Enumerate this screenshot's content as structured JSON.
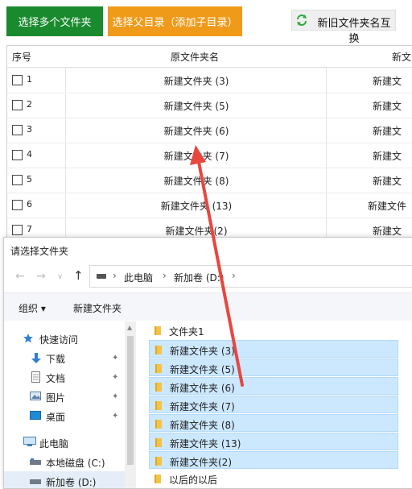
{
  "toolbar": {
    "select_folders": "选择多个文件夹",
    "select_parent": "选择父目录（添加子目录）",
    "swap_names": "新旧文件夹名互换"
  },
  "table": {
    "headers": {
      "seq": "序号",
      "original": "原文件夹名",
      "new": "新文"
    },
    "rows": [
      {
        "num": "1",
        "original": "新建文件夹 (3)",
        "new": "新建文"
      },
      {
        "num": "2",
        "original": "新建文件夹 (5)",
        "new": "新建文"
      },
      {
        "num": "3",
        "original": "新建文件夹 (6)",
        "new": "新建文"
      },
      {
        "num": "4",
        "original": "新建文件夹 (7)",
        "new": "新建文"
      },
      {
        "num": "5",
        "original": "新建文件夹 (8)",
        "new": "新建文"
      },
      {
        "num": "6",
        "original": "新建文件夹 (13)",
        "new": "新建文件"
      },
      {
        "num": "7",
        "original": "新建文件夹(2)",
        "new": "新建文"
      }
    ]
  },
  "dialog": {
    "title": "请选择文件夹",
    "address": {
      "segments": [
        "此电脑",
        "新加卷 (D:)"
      ]
    },
    "commands": {
      "organize": "组织 ▾",
      "new_folder": "新建文件夹"
    },
    "nav": {
      "quick_access": "快速访问",
      "items": [
        "下载",
        "文档",
        "图片",
        "桌面"
      ],
      "this_pc": "此电脑",
      "drives": [
        "本地磁盘 (C:)",
        "新加卷 (D:)"
      ]
    },
    "files": [
      {
        "name": "文件夹1",
        "selected": false
      },
      {
        "name": "新建文件夹 (3)",
        "selected": true
      },
      {
        "name": "新建文件夹 (5)",
        "selected": true
      },
      {
        "name": "新建文件夹 (6)",
        "selected": true
      },
      {
        "name": "新建文件夹 (7)",
        "selected": true
      },
      {
        "name": "新建文件夹 (8)",
        "selected": true
      },
      {
        "name": "新建文件夹 (13)",
        "selected": true
      },
      {
        "name": "新建文件夹(2)",
        "selected": true
      },
      {
        "name": "以后的以后",
        "selected": false
      }
    ]
  },
  "colors": {
    "green_button": "#1a8a2e",
    "orange_button": "#f09a1a",
    "selection": "#cce8ff",
    "arrow": "#e8473f"
  }
}
